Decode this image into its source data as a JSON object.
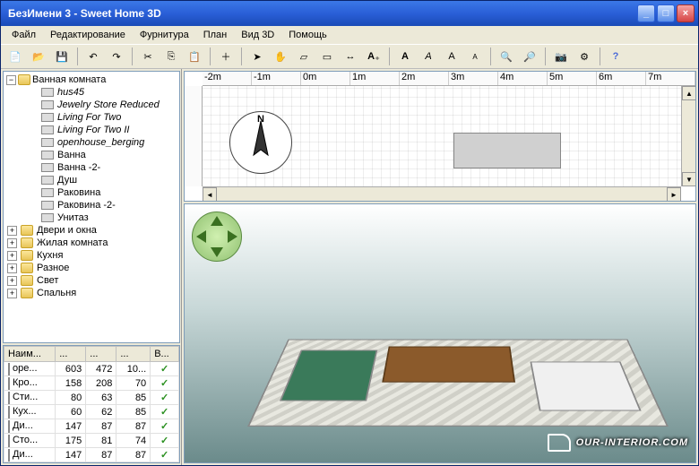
{
  "window_title": "БезИмени 3 - Sweet Home 3D",
  "menu": {
    "file": "Файл",
    "edit": "Редактирование",
    "furniture": "Фурнитура",
    "plan": "План",
    "view3d": "Вид 3D",
    "help": "Помощь"
  },
  "toolbar_icons": [
    "new",
    "open",
    "save",
    "undo",
    "redo",
    "cut",
    "copy",
    "paste",
    "select",
    "pan",
    "wall",
    "room",
    "dimension",
    "text",
    "add-furniture",
    "import",
    "rotate-left",
    "rotate-right",
    "flip-h",
    "flip-v",
    "zoom-in",
    "zoom-out",
    "camera",
    "preferences",
    "help"
  ],
  "catalog": {
    "root": {
      "label": "Ванная комната",
      "expanded": true
    },
    "children": [
      {
        "label": "hus45",
        "italic": true
      },
      {
        "label": "Jewelry Store Reduced",
        "italic": true
      },
      {
        "label": "Living For Two",
        "italic": true
      },
      {
        "label": "Living For Two II",
        "italic": true
      },
      {
        "label": "openhouse_berging",
        "italic": true
      },
      {
        "label": "Ванна",
        "italic": false
      },
      {
        "label": "Ванна -2-",
        "italic": false
      },
      {
        "label": "Душ",
        "italic": false
      },
      {
        "label": "Раковина",
        "italic": false
      },
      {
        "label": "Раковина -2-",
        "italic": false
      },
      {
        "label": "Унитаз",
        "italic": false
      }
    ],
    "collapsed": [
      "Двери и окна",
      "Жилая комната",
      "Кухня",
      "Разное",
      "Свет",
      "Спальня"
    ]
  },
  "furniture_table": {
    "headers": [
      "Наим...",
      "...",
      "...",
      "...",
      "В..."
    ],
    "rows": [
      {
        "name": "ope...",
        "w": "603",
        "d": "472",
        "h": "10...",
        "v": "✓"
      },
      {
        "name": "Кро...",
        "w": "158",
        "d": "208",
        "h": "70",
        "v": "✓"
      },
      {
        "name": "Сти...",
        "w": "80",
        "d": "63",
        "h": "85",
        "v": "✓"
      },
      {
        "name": "Кух...",
        "w": "60",
        "d": "62",
        "h": "85",
        "v": "✓"
      },
      {
        "name": "Ди...",
        "w": "147",
        "d": "87",
        "h": "87",
        "v": "✓"
      },
      {
        "name": "Сто...",
        "w": "175",
        "d": "81",
        "h": "74",
        "v": "✓"
      },
      {
        "name": "Ди...",
        "w": "147",
        "d": "87",
        "h": "87",
        "v": "✓"
      }
    ]
  },
  "ruler_ticks": [
    "-2m",
    "-1m",
    "0m",
    "1m",
    "2m",
    "3m",
    "4m",
    "5m",
    "6m",
    "7m"
  ],
  "compass_label": "N",
  "watermark": "OUR-INTERIOR.COM"
}
